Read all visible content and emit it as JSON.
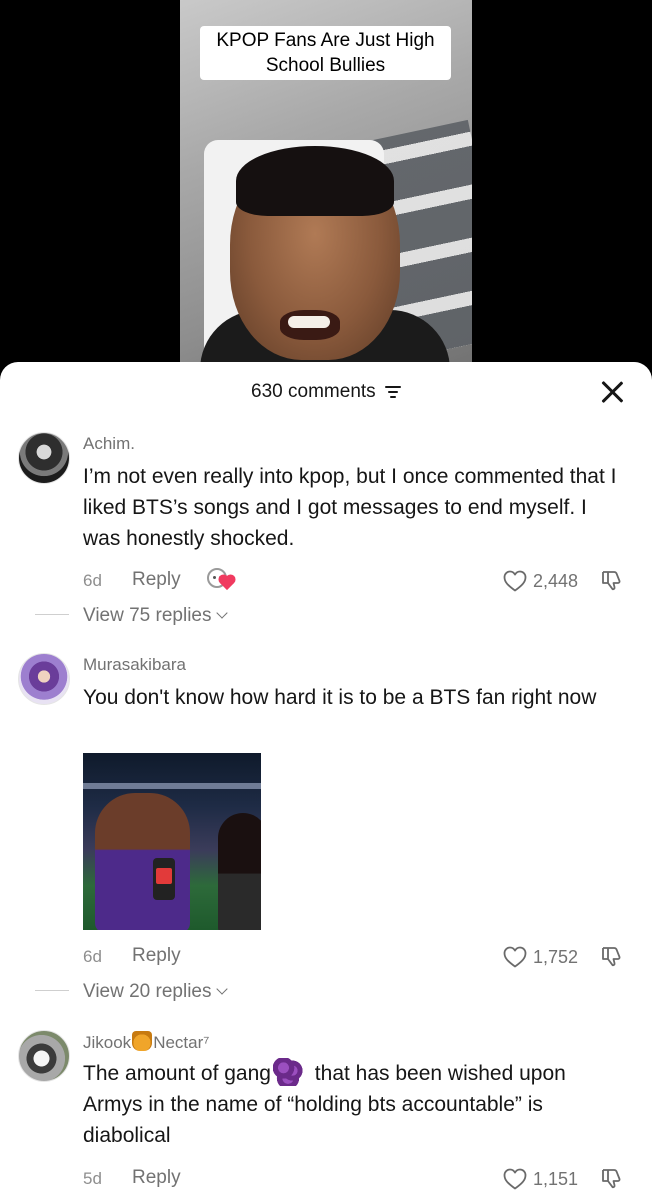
{
  "video": {
    "caption_line1": "KPOP Fans Are Just High",
    "caption_line2": "School Bullies"
  },
  "sheet": {
    "comment_count": "630 comments"
  },
  "comments": [
    {
      "username": "Achim.",
      "text": "I’m not even really into kpop, but I once commented that I liked BTS’s songs and I got messages to end myself. I was honestly shocked.",
      "time": "6d",
      "reply_label": "Reply",
      "likes": "2,448",
      "view_replies": "View 75 replies"
    },
    {
      "username": "Murasakibara",
      "text": "You don't know how hard it is to be a BTS fan right now",
      "time": "6d",
      "reply_label": "Reply",
      "likes": "1,752",
      "view_replies": "View 20 replies"
    },
    {
      "username_part1": "Jikook",
      "username_part2": "Nectar⁷",
      "text_part1": "The amount of gang",
      "text_part2": " that has been wished upon Armys in the name of “holding bts accountable” is diabolical",
      "time": "5d",
      "reply_label": "Reply",
      "likes": "1,151"
    }
  ],
  "icons": {
    "close": "close-icon",
    "sort": "sort-icon",
    "like": "heart-outline-icon",
    "dislike": "thumbs-down-icon",
    "reply_emoji": "emoji-heart-icon",
    "honey": "honey-pot-emoji",
    "grapes": "grapes-emoji"
  },
  "colors": {
    "sheet_background": "#ffffff",
    "primary_text": "#161616",
    "secondary_text": "#727272",
    "heart_red": "#f03a5f"
  }
}
